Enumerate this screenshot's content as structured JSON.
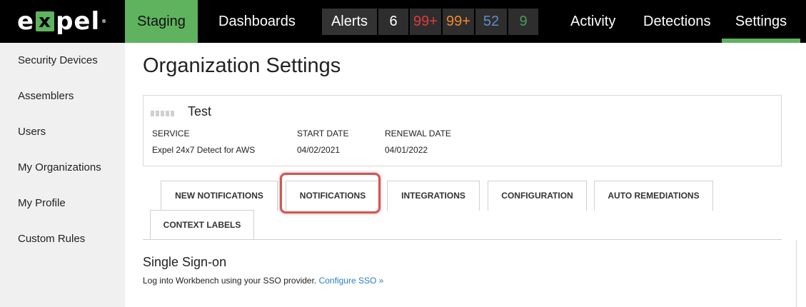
{
  "topnav": {
    "logo_pre": "e",
    "logo_x": "x",
    "logo_post": "pel",
    "logo_tm": "®",
    "environment": "Staging",
    "dashboards": "Dashboards",
    "alerts_label": "Alerts",
    "alert_counts": [
      "6",
      "99+",
      "99+",
      "52",
      "9"
    ],
    "alert_colors": [
      "#ffffff",
      "#e03a3a",
      "#ef8a2e",
      "#5f8ec8",
      "#4f9a5a"
    ],
    "activity": "Activity",
    "detections": "Detections",
    "settings": "Settings"
  },
  "sidebar": {
    "items": [
      {
        "label": "Security Devices"
      },
      {
        "label": "Assemblers"
      },
      {
        "label": "Users"
      },
      {
        "label": "My Organizations"
      },
      {
        "label": "My Profile"
      },
      {
        "label": "Custom Rules"
      }
    ]
  },
  "main": {
    "title": "Organization Settings",
    "org": {
      "name": "Test",
      "service_header": "SERVICE",
      "service_value": "Expel 24x7 Detect for AWS",
      "start_header": "START DATE",
      "start_value": "04/02/2021",
      "renewal_header": "RENEWAL DATE",
      "renewal_value": "04/01/2022"
    },
    "tabs": [
      {
        "label": "NEW NOTIFICATIONS"
      },
      {
        "label": "NOTIFICATIONS"
      },
      {
        "label": "INTEGRATIONS"
      },
      {
        "label": "CONFIGURATION"
      },
      {
        "label": "AUTO REMEDIATIONS"
      },
      {
        "label": "CONTEXT LABELS"
      }
    ],
    "sso": {
      "title": "Single Sign-on",
      "text": "Log into Workbench using your SSO provider.",
      "link": "Configure SSO »"
    }
  },
  "colors": {
    "brand_green": "#5fb35f",
    "highlight_red": "#d9534f",
    "link_blue": "#2a7bc4"
  }
}
